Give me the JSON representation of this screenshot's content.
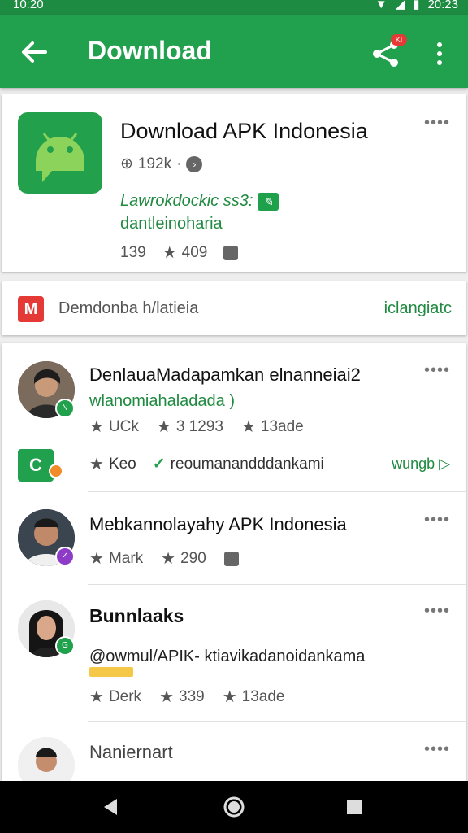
{
  "status": {
    "time": "10:20",
    "clock": "20:23"
  },
  "appbar": {
    "title": "Download",
    "badge": "KI"
  },
  "app_card": {
    "title": "Download APK Indonesia",
    "downloads": "192k",
    "link1": "Lawrokdockic ss3:",
    "link2": "dantleinoharia",
    "stat1": "139",
    "rating": "409"
  },
  "search_row": {
    "text": "Demdonba h/latieia",
    "action": "iclangiatc"
  },
  "list": {
    "item1": {
      "name": "DenlauaMadapamkan elnanneiai2",
      "sub": "wlanomiahaladada )",
      "stat1": "UCk",
      "stat2": "3 1293",
      "stat3": "13ade",
      "row2_star": "Keo",
      "row2_text": "reoumanandddankami",
      "row2_action": "wungb"
    },
    "item2": {
      "name": "Mebkannolayahy APK Indonesia",
      "stat1": "Mark",
      "stat2": "290"
    },
    "item3": {
      "name": "Bunnlaaks",
      "sub": "@owmul/APIK-  ktiavikadanoidankama",
      "stat1": "Derk",
      "stat2": "339",
      "stat3": "13ade"
    },
    "item4": {
      "name": "Naniernart"
    }
  },
  "colors": {
    "primary": "#21a04d",
    "dark": "#1e8b43",
    "accent": "#1f8a40"
  }
}
